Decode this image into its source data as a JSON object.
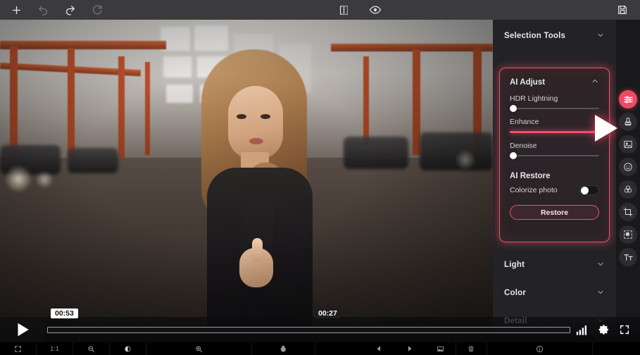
{
  "app": {
    "accent": "#e8536b",
    "accent_active": "#ef4a63",
    "panel_bg": "#232326",
    "toolbar_bg": "#3b3b3d"
  },
  "topbar": {
    "left_buttons": [
      {
        "name": "add-icon",
        "label": "Add",
        "enabled": true
      },
      {
        "name": "undo-icon",
        "label": "Undo",
        "enabled": false
      },
      {
        "name": "redo-icon",
        "label": "Redo",
        "enabled": true
      },
      {
        "name": "reset-icon",
        "label": "Reset",
        "enabled": false
      }
    ],
    "center_buttons": [
      {
        "name": "compare-split-icon",
        "label": "Compare"
      },
      {
        "name": "preview-eye-icon",
        "label": "Preview"
      }
    ],
    "right_buttons": [
      {
        "name": "save-icon",
        "label": "Save"
      }
    ]
  },
  "panel": {
    "sections": [
      {
        "id": "selection-tools",
        "label": "Selection Tools",
        "expanded": false,
        "chevron": "chevron-down-icon"
      },
      {
        "id": "light",
        "label": "Light",
        "expanded": false,
        "chevron": "chevron-down-icon"
      },
      {
        "id": "color",
        "label": "Color",
        "expanded": false,
        "chevron": "chevron-down-icon"
      },
      {
        "id": "detail",
        "label": "Detail",
        "expanded": false,
        "chevron": "chevron-down-icon"
      }
    ],
    "ai_adjust": {
      "title": "AI Adjust",
      "expanded": true,
      "chevron": "chevron-up-icon",
      "sliders": [
        {
          "label": "HDR Lightning",
          "value": 0,
          "active": false
        },
        {
          "label": "Enhance",
          "value": 100,
          "active": true
        },
        {
          "label": "Denoise",
          "value": 0,
          "active": false
        }
      ],
      "restore": {
        "title": "AI Restore",
        "toggle_label": "Colorize photo",
        "toggle_on": false,
        "button_label": "Restore"
      }
    }
  },
  "rail": {
    "items": [
      {
        "name": "adjust-sliders-icon",
        "label": "Adjust",
        "active": true
      },
      {
        "name": "stamp-icon",
        "label": "Stamp",
        "active": false
      },
      {
        "name": "image-icon",
        "label": "Image",
        "active": false
      },
      {
        "name": "smiley-icon",
        "label": "Portrait",
        "active": false
      },
      {
        "name": "color-wheel-icon",
        "label": "Color",
        "active": false
      },
      {
        "name": "crop-icon",
        "label": "Crop",
        "active": false
      },
      {
        "name": "resize-select-icon",
        "label": "Resize",
        "active": false
      },
      {
        "name": "text-icon",
        "label": "Text",
        "active": false
      }
    ]
  },
  "player": {
    "play_label": "Play",
    "hover_time": "00:53",
    "current_time": "00:27",
    "progress_percent": 0,
    "controls": [
      {
        "name": "quality-bars-icon",
        "label": "Quality"
      },
      {
        "name": "settings-gear-icon",
        "label": "Settings"
      },
      {
        "name": "fullscreen-icon",
        "label": "Fullscreen"
      }
    ]
  },
  "bottombar": {
    "items": [
      {
        "name": "fit-screen-icon",
        "label": ""
      },
      {
        "name": "zoom-ratio-label",
        "label": "1:1"
      },
      {
        "name": "zoom-out-icon",
        "label": ""
      },
      {
        "name": "brightness-icon",
        "label": ""
      },
      {
        "name": "zoom-in-icon",
        "label": ""
      },
      {
        "name": "hand-tool-icon",
        "label": ""
      },
      {
        "name": "prev-arrow-icon",
        "label": ""
      },
      {
        "name": "next-arrow-icon",
        "label": ""
      },
      {
        "name": "thumbnail-icon",
        "label": ""
      },
      {
        "name": "delete-icon",
        "label": ""
      },
      {
        "name": "info-icon",
        "label": ""
      }
    ]
  }
}
